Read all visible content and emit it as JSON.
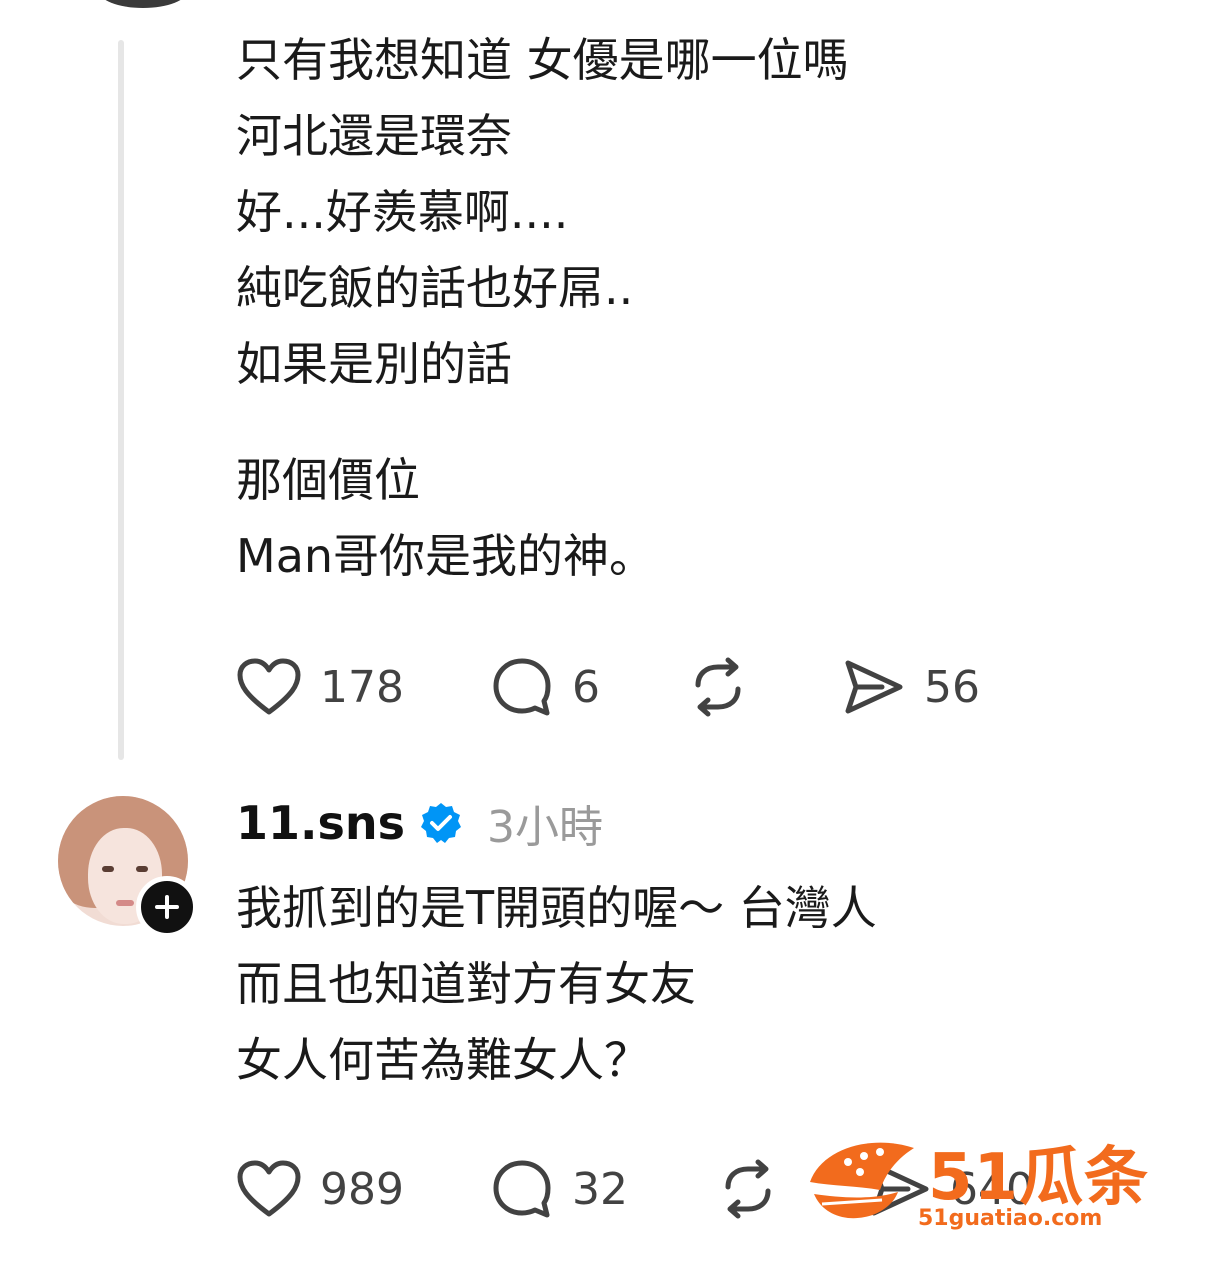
{
  "post1": {
    "lines": [
      "只有我想知道 女優是哪一位嗎",
      "河北還是環奈",
      "好...好羨慕啊....",
      "純吃飯的話也好屌..",
      "如果是別的話",
      "那個價位",
      "Man哥你是我的神。"
    ],
    "stats": {
      "likes": "178",
      "replies": "6",
      "shares": "56"
    }
  },
  "post2": {
    "username": "11.sns",
    "timestamp": "3小時",
    "lines": [
      "我抓到的是T開頭的喔～ 台灣人",
      "而且也知道對方有女友",
      "女人何苦為難女人？"
    ],
    "stats": {
      "likes": "989",
      "replies": "32",
      "shares": "640"
    }
  },
  "watermark": {
    "brand": "51瓜条",
    "url": "51guatiao.com"
  },
  "colors": {
    "verified": "#0095f6",
    "watermark": "#f26b1d",
    "icon": "#424242"
  },
  "icons": [
    "heart-icon",
    "comment-icon",
    "repost-icon",
    "share-icon",
    "verified-badge-icon",
    "plus-icon"
  ]
}
